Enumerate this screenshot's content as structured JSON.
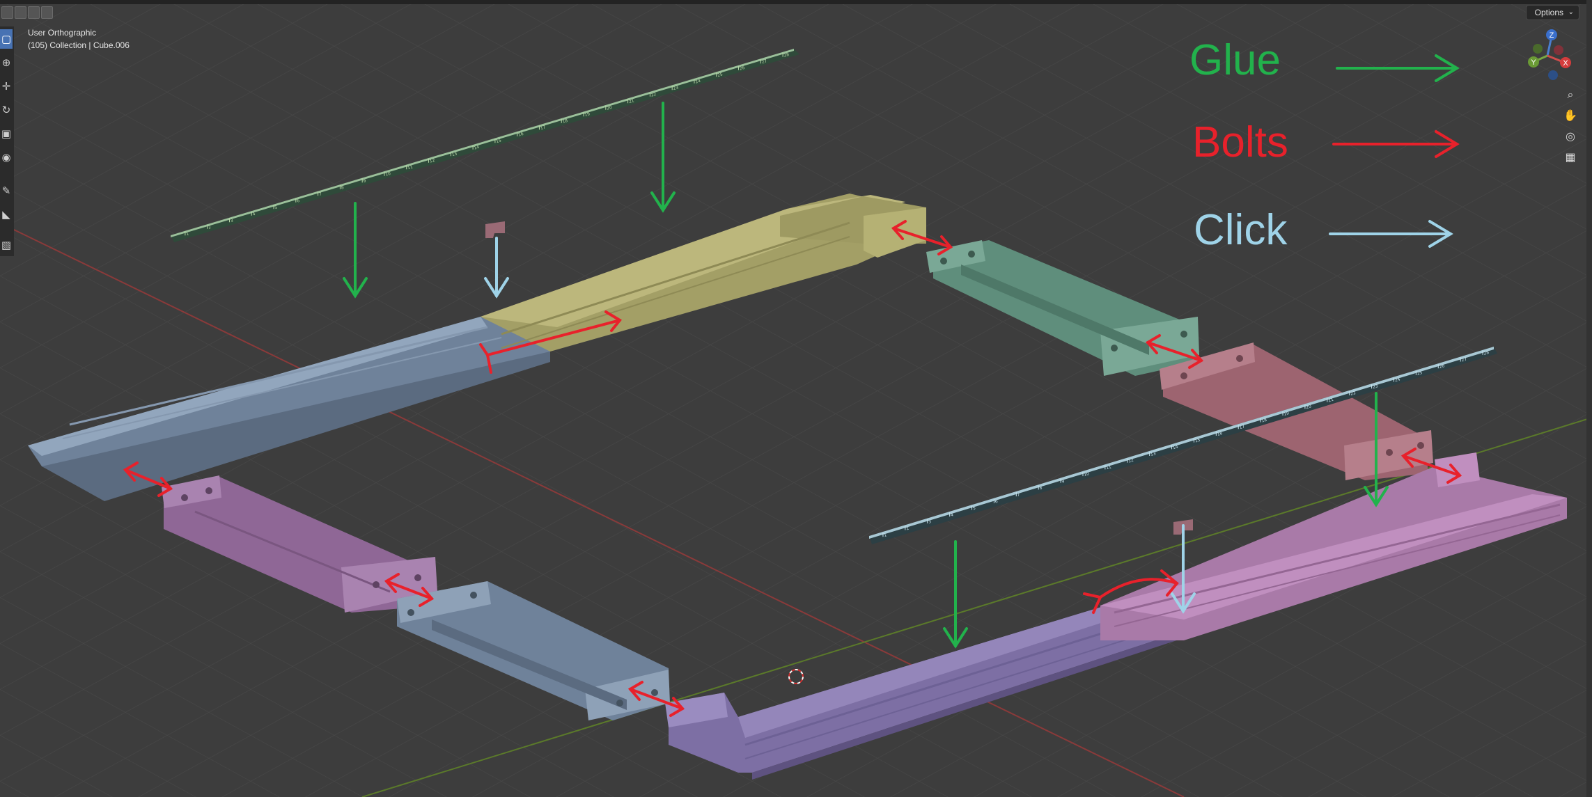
{
  "viewport": {
    "view_name": "User Orthographic",
    "object_info": "(105) Collection | Cube.006",
    "options_label": "Options"
  },
  "legend": {
    "glue": {
      "label": "Glue",
      "color": "#22b24c"
    },
    "bolts": {
      "label": "Bolts",
      "color": "#e8212b"
    },
    "click": {
      "label": "Click",
      "color": "#9fd3e8"
    }
  },
  "gizmo_axes": {
    "z": "Z",
    "y": "Y",
    "x": "X"
  },
  "toolbar_icons": [
    "select-box-icon",
    "cursor-icon",
    "move-icon",
    "rotate-icon",
    "scale-icon",
    "transform-icon",
    "annotate-icon",
    "measure-icon",
    "add-cube-icon"
  ],
  "nav_icons": [
    "zoom-icon",
    "pan-hand-icon",
    "camera-icon",
    "grid-icon"
  ],
  "ruler_numbers": [
    "1",
    "2",
    "3",
    "4",
    "5",
    "6",
    "7",
    "8",
    "9",
    "10",
    "11",
    "12",
    "13",
    "14",
    "15",
    "16",
    "17",
    "18",
    "19",
    "20",
    "21",
    "22",
    "23",
    "24",
    "25",
    "26",
    "27",
    "28"
  ],
  "colors": {
    "background": "#3d3d3d",
    "grid": "#484848",
    "axis_x": "#8a3a3a",
    "axis_y": "#5b7a2a",
    "part_blue": "#7b8fa7",
    "part_yellow": "#a7a36a",
    "part_green": "#6b9a88",
    "part_pink": "#a9707d",
    "part_purple": "#9a739f",
    "part_violet": "#8779ab",
    "ruler": "#2a3a30"
  }
}
